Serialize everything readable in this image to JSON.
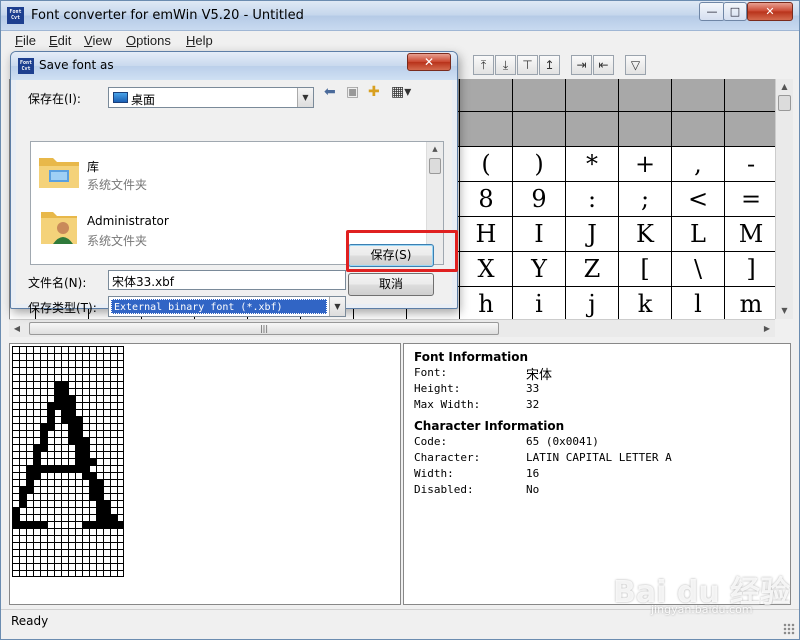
{
  "window": {
    "title": "Font converter for emWin V5.20 - Untitled",
    "controls": {
      "minimize": "—",
      "maximize": "□",
      "close": "✕"
    }
  },
  "menu": [
    {
      "label": "File",
      "mnemonic": "F"
    },
    {
      "label": "Edit",
      "mnemonic": "E"
    },
    {
      "label": "View",
      "mnemonic": "V"
    },
    {
      "label": "Options",
      "mnemonic": "O"
    },
    {
      "label": "Help",
      "mnemonic": "H"
    }
  ],
  "toolbar_icons": [
    "align-top-icon",
    "align-bottom-icon",
    "align-top-alt-icon",
    "align-up-icon",
    "shift-right-icon",
    "shift-left-icon",
    "filter-icon"
  ],
  "char_grid": {
    "rows": [
      [
        "",
        "",
        "",
        "",
        "",
        ""
      ],
      [
        "",
        "",
        "",
        "",
        "",
        ""
      ],
      [
        "(",
        ")",
        "*",
        "+",
        ",",
        "-"
      ],
      [
        "8",
        "9",
        ":",
        ";",
        "<",
        "="
      ],
      [
        "H",
        "I",
        "J",
        "K",
        "L",
        "M"
      ],
      [
        "X",
        "Y",
        "Z",
        "[",
        "\\",
        "]"
      ],
      [
        "h",
        "i",
        "j",
        "k",
        "l",
        "m"
      ]
    ],
    "disabled_rows": [
      0,
      1
    ]
  },
  "font_info": {
    "heading": "Font Information",
    "rows": [
      {
        "key": "Font:",
        "value": "宋体"
      },
      {
        "key": "Height:",
        "value": "33"
      },
      {
        "key": "Max Width:",
        "value": "32"
      }
    ]
  },
  "char_info": {
    "heading": "Character Information",
    "rows": [
      {
        "key": "Code:",
        "value": "65 (0x0041)"
      },
      {
        "key": "Character:",
        "value": "LATIN CAPITAL LETTER A"
      },
      {
        "key": "Width:",
        "value": "16"
      },
      {
        "key": "Disabled:",
        "value": "No"
      }
    ]
  },
  "status": "Ready",
  "dialog": {
    "title": "Save font as",
    "save_in_label": "保存在(I):",
    "save_in_value": "桌面",
    "files": [
      {
        "name": "库",
        "sub": "系统文件夹",
        "icon": "library-folder-icon"
      },
      {
        "name": "Administrator",
        "sub": "系统文件夹",
        "icon": "user-folder-icon"
      }
    ],
    "filename_label": "文件名(N):",
    "filename_value": "宋体33.xbf",
    "filetype_label": "保存类型(T):",
    "filetype_value": "External binary font (*.xbf)",
    "save_button": "保存(S)",
    "cancel_button": "取消"
  },
  "watermark": {
    "brand": "Bai du 经验",
    "url": "jingyan.baidu.com"
  },
  "colors": {
    "highlight": "#e02020",
    "selection": "#3165c5"
  }
}
